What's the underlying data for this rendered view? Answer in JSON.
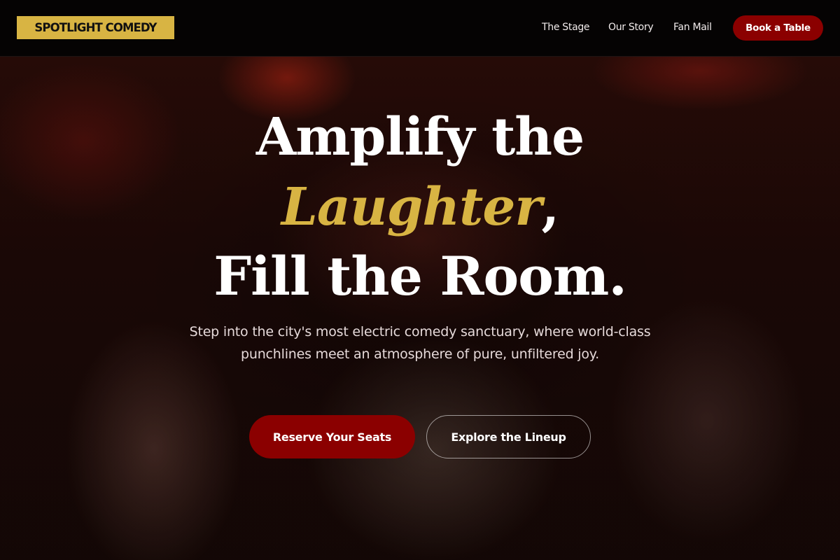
{
  "brand": {
    "logo_text": "SPOTLIGHT COMEDY",
    "accent_color": "#d8b443",
    "primary_color": "#8b0000"
  },
  "nav": {
    "links": [
      "The Stage",
      "Our Story",
      "Fan Mail"
    ],
    "cta_label": "Book a Table"
  },
  "hero": {
    "headline_line1": "Amplify the",
    "headline_accent": "Laughter",
    "headline_line2_suffix": ",",
    "headline_line3": "Fill the Room.",
    "subtext": "Step into the city's most electric comedy sanctuary, where world-class punchlines meet an atmosphere of pure, unfiltered joy.",
    "primary_button": "Reserve Your Seats",
    "secondary_button": "Explore the Lineup"
  }
}
